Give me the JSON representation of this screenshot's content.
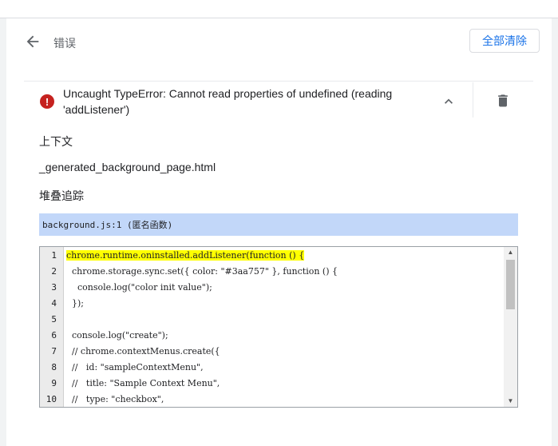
{
  "header": {
    "title": "错误",
    "clear_all": "全部清除"
  },
  "error": {
    "icon": "error-icon",
    "message_line1": "Uncaught TypeError: Cannot read properties of undefined (reading",
    "message_line2": "'addListener')"
  },
  "context": {
    "label": "上下文",
    "value": "_generated_background_page.html"
  },
  "stack": {
    "label": "堆叠追踪",
    "frame": "background.js:1 (匿名函数)"
  },
  "code": {
    "lines": [
      {
        "num": "1",
        "text": "chrome.runtime.oninstalled.addListener(function () {",
        "highlight": true
      },
      {
        "num": "2",
        "text": "  chrome.storage.sync.set({ color: \"#3aa757\" }, function () {"
      },
      {
        "num": "3",
        "text": "    console.log(\"color init value\");"
      },
      {
        "num": "4",
        "text": "  });"
      },
      {
        "num": "5",
        "text": ""
      },
      {
        "num": "6",
        "text": "  console.log(\"create\");"
      },
      {
        "num": "7",
        "text": "  // chrome.contextMenus.create({"
      },
      {
        "num": "8",
        "text": "  //   id: \"sampleContextMenu\","
      },
      {
        "num": "9",
        "text": "  //   title: \"Sample Context Menu\","
      },
      {
        "num": "10",
        "text": "  //   type: \"checkbox\","
      }
    ]
  },
  "colors": {
    "accent": "#1a73e8",
    "error": "#c5221f",
    "highlight": "#ffff00",
    "stack_bg": "#c2d7f9"
  }
}
